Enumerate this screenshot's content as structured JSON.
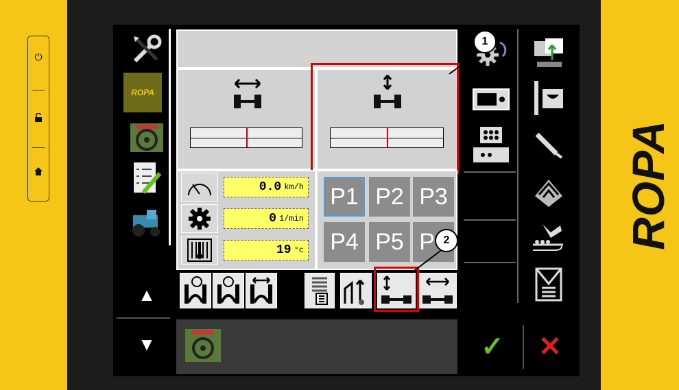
{
  "brand": {
    "vertical_text": "ROPA",
    "logo_tile": "ROPA"
  },
  "hard_keys": [
    {
      "icon": "power-icon",
      "glyph": "⏻"
    },
    {
      "icon": "unlock-icon",
      "glyph": "🔓"
    },
    {
      "icon": "home-icon",
      "glyph": "⌂"
    }
  ],
  "left_menu": {
    "items": [
      "wrench-screwdriver-icon",
      "ropa-logo",
      "steering-wheel-icon",
      "checklist-icon",
      "tractor-icon"
    ],
    "arrow_up": "▲",
    "arrow_down": "▼"
  },
  "chassis": {
    "left_panel_icon": "width-adjust-icon",
    "right_panel_icon": "height-adjust-icon",
    "left_position_pct": 50,
    "right_position_pct": 50
  },
  "gauges": [
    {
      "icon": "speedometer-icon",
      "value": "0.0",
      "unit": "km/h"
    },
    {
      "icon": "gear-icon",
      "value": "0",
      "unit": "1/min"
    },
    {
      "icon": "temperature-icon",
      "value": "19",
      "unit": "°c"
    }
  ],
  "presets": [
    "P1",
    "P2",
    "P3",
    "P4",
    "P5",
    "P6"
  ],
  "presets_selected": "P1",
  "tool_row": [
    "crop-guide-1-icon",
    "crop-guide-2-icon",
    "track-width-icon",
    "sieve-icon",
    "lift-icon",
    "height-chassis-icon",
    "width-chassis-icon"
  ],
  "right_menu": [
    "settings-rotate-icon",
    "transfer-icon",
    "display-unit-icon",
    "cutter-icon",
    "keypad-unit-icon",
    "knife-icon",
    "",
    "cleaner-icon",
    "",
    "hand-conveyor-icon",
    "",
    "manual-icon"
  ],
  "callouts": [
    "1",
    "2"
  ],
  "bottom_bar": {
    "confirm": "✓",
    "cancel": "✕"
  },
  "colors": {
    "highlight": "#e00000",
    "value_bg": "#ffff66",
    "confirm": "#6abf1f",
    "cancel": "#e02020"
  }
}
